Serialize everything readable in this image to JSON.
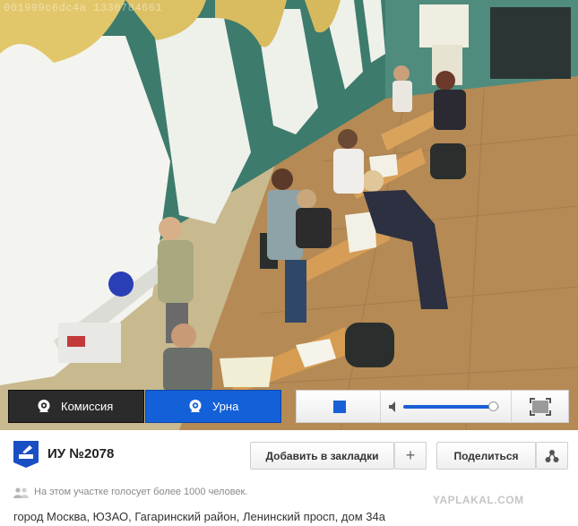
{
  "video": {
    "overlay_text": "001999c6dc4a 1330784661"
  },
  "controls": {
    "tabs": [
      {
        "label": "Комиссия",
        "icon": "webcam-icon",
        "active": false
      },
      {
        "label": "Урна",
        "icon": "webcam-icon",
        "active": true
      }
    ],
    "stop_icon": "stop-icon",
    "volume_icon": "speaker-icon",
    "volume_level": 0.93,
    "fullscreen_icon": "fullscreen-icon"
  },
  "info": {
    "station_icon": "ballot-box-icon",
    "title": "ИУ №2078",
    "bookmark_label": "Добавить в закладки",
    "bookmark_plus": "+",
    "share_label": "Поделиться",
    "share_icon": "share-nodes-icon",
    "voters_icon": "people-icon",
    "voters_text": "На этом участке голосует более 1000 человек.",
    "watermark": "YAPLAKAL.COM",
    "address": "город Москва, ЮЗАО, Гагаринский район, Ленинский просп, дом 34а"
  },
  "colors": {
    "accent_blue": "#1360d8",
    "dark_tab": "#2b2b2b"
  }
}
